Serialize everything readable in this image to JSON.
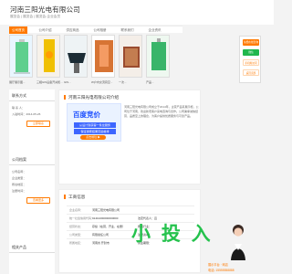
{
  "header": {
    "company": "河南三阳光电有限公司",
    "subtitle": "展览会 | 展览会 | 展览会-企业会员"
  },
  "nav": {
    "items": [
      "公司首页",
      "公司介绍",
      "供应商品",
      "公司相册",
      "联系我们",
      "企业资讯"
    ],
    "active_index": 0
  },
  "thumbs": [
    {
      "caption": "展厅展示图..."
    },
    {
      "caption": "三相GIS设备开关柜..."
    },
    {
      "caption": "GIS..."
    },
    {
      "caption": "W户内交流真空..."
    },
    {
      "caption": "一次..."
    },
    {
      "caption": "产品..."
    },
    {
      "caption": "..."
    }
  ],
  "sidebar": {
    "contact_title": "联系方式",
    "contact_person": "联 系 人：",
    "joined_date": "入驻时间：2014-05-26",
    "contact_button": "立即联系",
    "company_title": "公司档案",
    "company_name": "公司名称：",
    "company_type": "企业类型：",
    "company_location": "所在地区：",
    "register_time": "注册时间：",
    "view_more_button": "查看更多",
    "product_title": "相关产品"
  },
  "main": {
    "intro_title": "河南三阳光电有限公司介绍",
    "intro_text": "河南三阳光电有限公司成立于2014年，主营产品有展示柜，公司位于河南，欢迎新老客户来电咨询与合作。公司秉承诚信经营、品质至上的理念，为客户提供优质服务与可靠产品。",
    "ad_title": "百度竞价",
    "ad_line1": "从设计到获客一条龙服务",
    "ad_line2": "保证搜索结果页最前排",
    "ad_button": "点击前往 ▶",
    "reg_title": "工商信息",
    "reg_rows": [
      {
        "label": "企业名称：",
        "value": "河南三阳光电有限公司",
        "right": ""
      },
      {
        "label": "统一社会信用代码：",
        "value": "91410200000000000",
        "right": "法定代表人：吕"
      },
      {
        "label": "经营状态：",
        "value": "存续（在营、开业、在册）",
        "right": "所属行业："
      },
      {
        "label": "公司类型：",
        "value": "有限责任公司",
        "right": "注册资本："
      },
      {
        "label": "所属地区：",
        "value": "河南省 开封市",
        "right": "营业期限："
      }
    ]
  },
  "right_tools": {
    "item1": "免费在线咨询",
    "item2": "微信",
    "item3": "手机端访问",
    "item4": "返回顶部"
  },
  "watermark": {
    "title": "小 投 入",
    "text": "展示平台 · 网店",
    "phone": "电话: 15555558888"
  }
}
